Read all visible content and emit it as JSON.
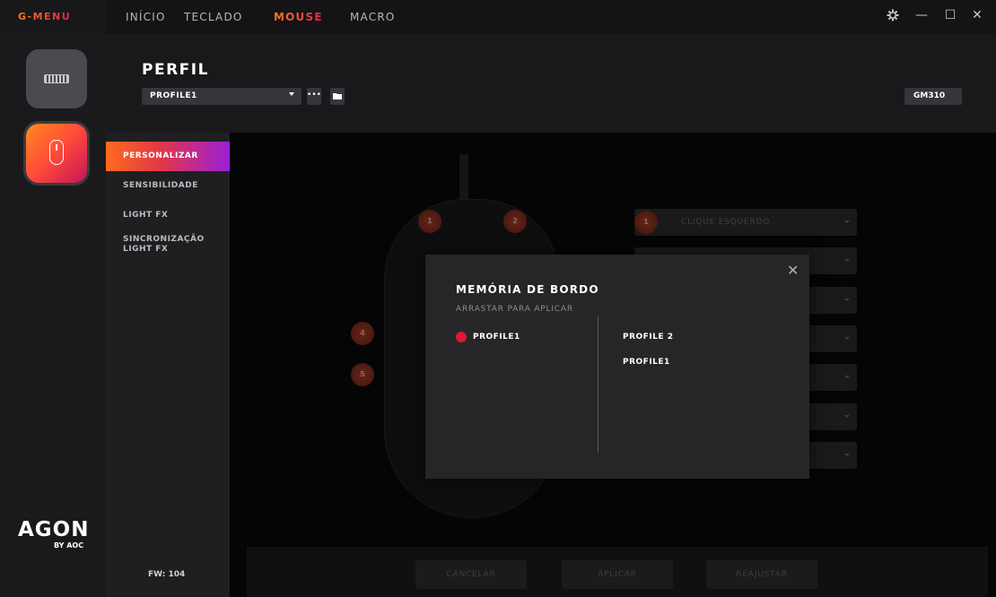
{
  "app": {
    "brand": "G-MENU"
  },
  "nav": {
    "items": [
      {
        "label": "INÍCIO"
      },
      {
        "label": "TECLADO"
      },
      {
        "label": "MOUSE",
        "active": true
      },
      {
        "label": "MACRO"
      }
    ]
  },
  "window": {
    "settings_icon": "gear-icon",
    "minimize": "—",
    "maximize": "☐",
    "close": "✕"
  },
  "rail": {
    "logo": "AGON",
    "logo_sub": "BY AOC"
  },
  "header": {
    "title": "PERFIL",
    "profile_selected": "PROFILE1",
    "more_label": "•••",
    "model": "GM310"
  },
  "sidemenu": {
    "items": [
      {
        "label": "PERSONALIZAR",
        "active": true
      },
      {
        "label": "SENSIBILIDADE"
      },
      {
        "label": "LIGHT FX"
      },
      {
        "label": "SINCRONIZAÇÃO\nLIGHT FX"
      }
    ],
    "firmware": "FW: 104"
  },
  "mouse": {
    "hotspots": [
      "1",
      "2",
      "4",
      "5"
    ]
  },
  "assignments": {
    "first_slot_number": "1",
    "first_slot_label": "CLIQUE ESQUERDO"
  },
  "bottom": {
    "cancel": "CANCELAR",
    "apply": "APLICAR",
    "reset": "REAJUSTAR"
  },
  "modal": {
    "title": "MEMÓRIA DE BORDO",
    "subtitle": "ARRASTAR PARA APLICAR",
    "close": "✕",
    "onboard_profile": "PROFILE1",
    "profiles": [
      "PROFILE 2",
      "PROFILE1"
    ],
    "accent": "#e01834"
  },
  "colors": {
    "accent_orange": "#ff7a1a",
    "accent_red": "#e0224e",
    "accent_purple": "#9b1fd6"
  }
}
